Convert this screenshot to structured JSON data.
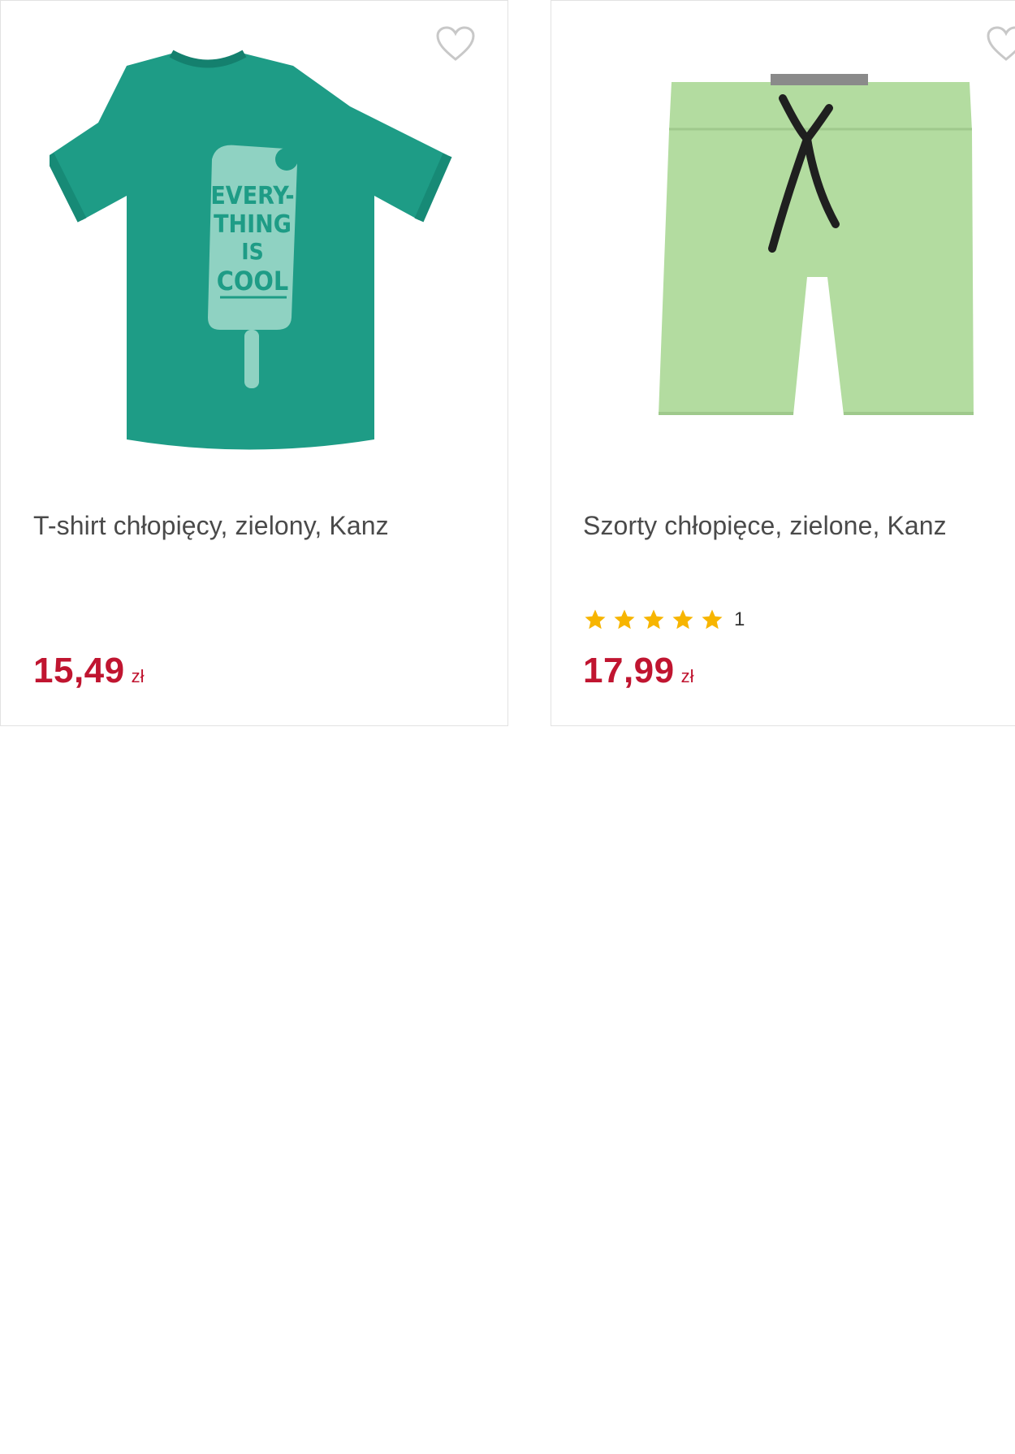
{
  "products": [
    {
      "title": "T-shirt chłopięcy, zielony, Kanz",
      "price": "15,49",
      "currency": "zł",
      "image": {
        "icon": "green-tshirt-image",
        "print_text": [
          "EVERY-",
          "THING",
          "IS",
          "COOL"
        ]
      },
      "favorite_icon": "heart-outline-icon"
    },
    {
      "title": "Szorty chłopięce, zielone, Kanz",
      "price": "17,99",
      "currency": "zł",
      "rating": {
        "stars": 5,
        "count": "1"
      },
      "image": {
        "icon": "green-shorts-image"
      },
      "favorite_icon": "heart-outline-icon"
    }
  ],
  "colors": {
    "price": "#c01530",
    "title": "#4a4a4a",
    "star": "#f7b500",
    "tshirt": "#1e9c86",
    "tshirt_print": "#8fd2c2",
    "shorts": "#b3dca0",
    "drawstring": "#1f1f1f",
    "border": "#e2e2e2"
  }
}
